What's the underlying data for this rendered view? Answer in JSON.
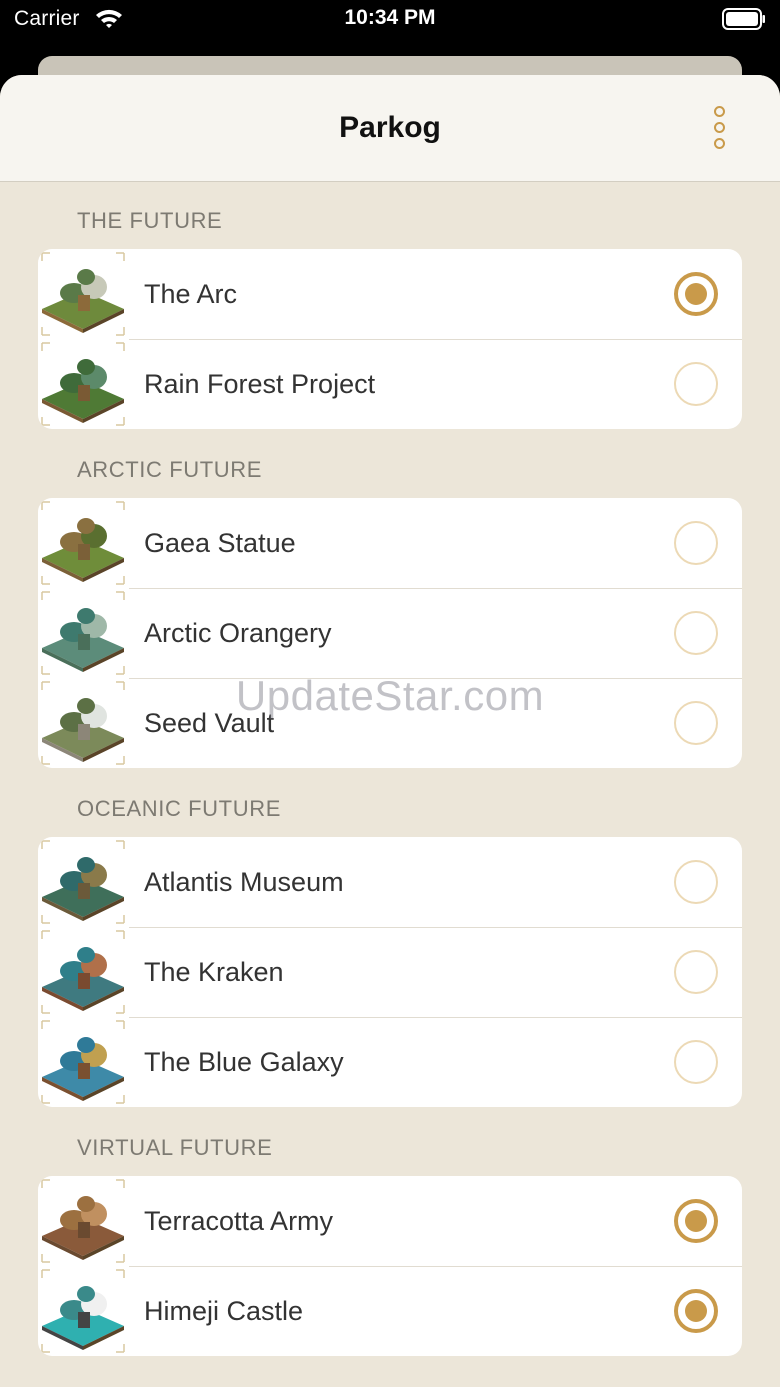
{
  "status_bar": {
    "carrier": "Carrier",
    "time": "10:34 PM"
  },
  "navbar": {
    "title": "Parkog"
  },
  "sections": [
    {
      "header": "THE FUTURE",
      "items": [
        {
          "label": "The Arc",
          "selected": true,
          "icon": "arc-building-icon"
        },
        {
          "label": "Rain Forest Project",
          "selected": false,
          "icon": "rainforest-building-icon"
        }
      ]
    },
    {
      "header": "ARCTIC FUTURE",
      "items": [
        {
          "label": "Gaea Statue",
          "selected": false,
          "icon": "gaea-statue-icon"
        },
        {
          "label": "Arctic Orangery",
          "selected": false,
          "icon": "orangery-building-icon"
        },
        {
          "label": "Seed Vault",
          "selected": false,
          "icon": "seed-vault-icon"
        }
      ]
    },
    {
      "header": "OCEANIC FUTURE",
      "items": [
        {
          "label": "Atlantis Museum",
          "selected": false,
          "icon": "atlantis-museum-icon"
        },
        {
          "label": "The Kraken",
          "selected": false,
          "icon": "kraken-building-icon"
        },
        {
          "label": "The Blue Galaxy",
          "selected": false,
          "icon": "blue-galaxy-icon"
        }
      ]
    },
    {
      "header": "VIRTUAL FUTURE",
      "items": [
        {
          "label": "Terracotta Army",
          "selected": true,
          "icon": "terracotta-army-icon"
        },
        {
          "label": "Himeji Castle",
          "selected": true,
          "icon": "himeji-castle-icon"
        }
      ]
    }
  ],
  "watermark": "UpdateStar.com",
  "colors": {
    "accent": "#c99a4a",
    "background": "#ece6d9"
  }
}
